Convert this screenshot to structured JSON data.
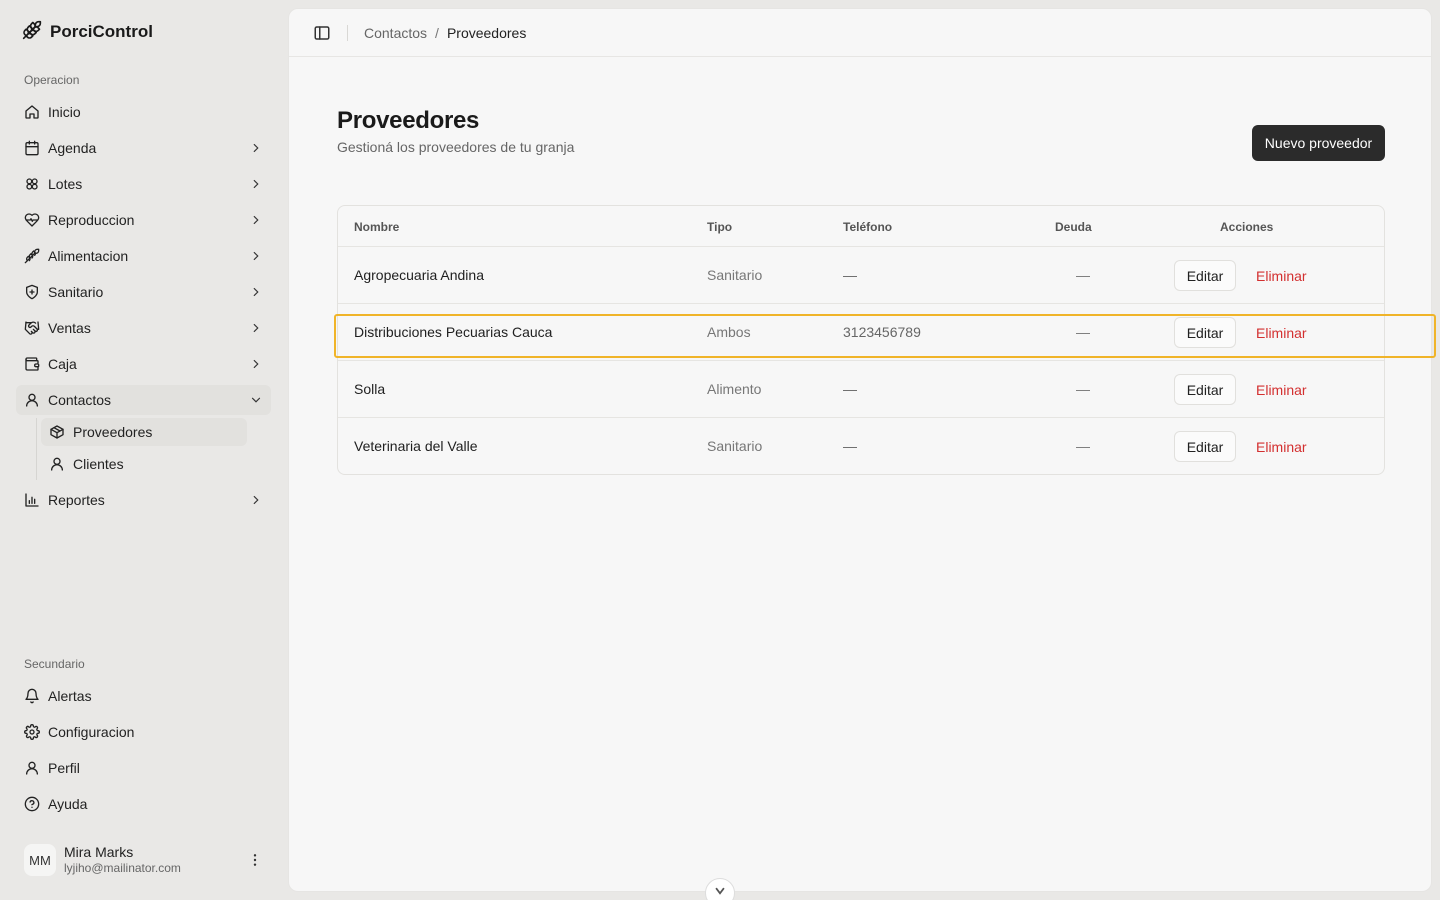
{
  "app": {
    "name": "PorciControl"
  },
  "sidebar": {
    "group_main": "Operacion",
    "items": [
      {
        "label": "Inicio",
        "icon": "home-icon"
      },
      {
        "label": "Agenda",
        "icon": "calendar-icon"
      },
      {
        "label": "Lotes",
        "icon": "lotes-icon"
      },
      {
        "label": "Reproduccion",
        "icon": "heart-pulse-icon"
      },
      {
        "label": "Alimentacion",
        "icon": "wheat-icon"
      },
      {
        "label": "Sanitario",
        "icon": "shield-plus-icon"
      },
      {
        "label": "Ventas",
        "icon": "handshake-icon"
      },
      {
        "label": "Caja",
        "icon": "wallet-icon"
      },
      {
        "label": "Contactos",
        "icon": "user-icon"
      },
      {
        "label": "Reportes",
        "icon": "bar-chart-icon"
      }
    ],
    "contactos_sub": [
      {
        "label": "Proveedores",
        "icon": "package-icon"
      },
      {
        "label": "Clientes",
        "icon": "user-icon"
      }
    ],
    "group_secondary": "Secundario",
    "secondary_items": [
      {
        "label": "Alertas",
        "icon": "bell-icon"
      },
      {
        "label": "Configuracion",
        "icon": "gear-icon"
      },
      {
        "label": "Perfil",
        "icon": "user-icon"
      },
      {
        "label": "Ayuda",
        "icon": "help-circle-icon"
      }
    ],
    "user": {
      "initials": "MM",
      "name": "Mira Marks",
      "email": "lyjiho@mailinator.com"
    }
  },
  "breadcrumb": {
    "parent": "Contactos",
    "separator": "/",
    "current": "Proveedores"
  },
  "page": {
    "title": "Proveedores",
    "subtitle": "Gestioná los proveedores de tu granja",
    "new_button": "Nuevo proveedor"
  },
  "table": {
    "headers": {
      "nombre": "Nombre",
      "tipo": "Tipo",
      "telefono": "Teléfono",
      "deuda": "Deuda",
      "acciones": "Acciones"
    },
    "edit_label": "Editar",
    "delete_label": "Eliminar",
    "rows": [
      {
        "nombre": "Agropecuaria Andina",
        "tipo": "Sanitario",
        "telefono": "—",
        "deuda": "—"
      },
      {
        "nombre": "Distribuciones Pecuarias Cauca",
        "tipo": "Ambos",
        "telefono": "3123456789",
        "deuda": "—"
      },
      {
        "nombre": "Solla",
        "tipo": "Alimento",
        "telefono": "—",
        "deuda": "—"
      },
      {
        "nombre": "Veterinaria del Valle",
        "tipo": "Sanitario",
        "telefono": "—",
        "deuda": "—"
      }
    ]
  },
  "colors": {
    "accent_dark": "#2b2b2b",
    "danger": "#d33030",
    "highlight": "#f0b429"
  }
}
